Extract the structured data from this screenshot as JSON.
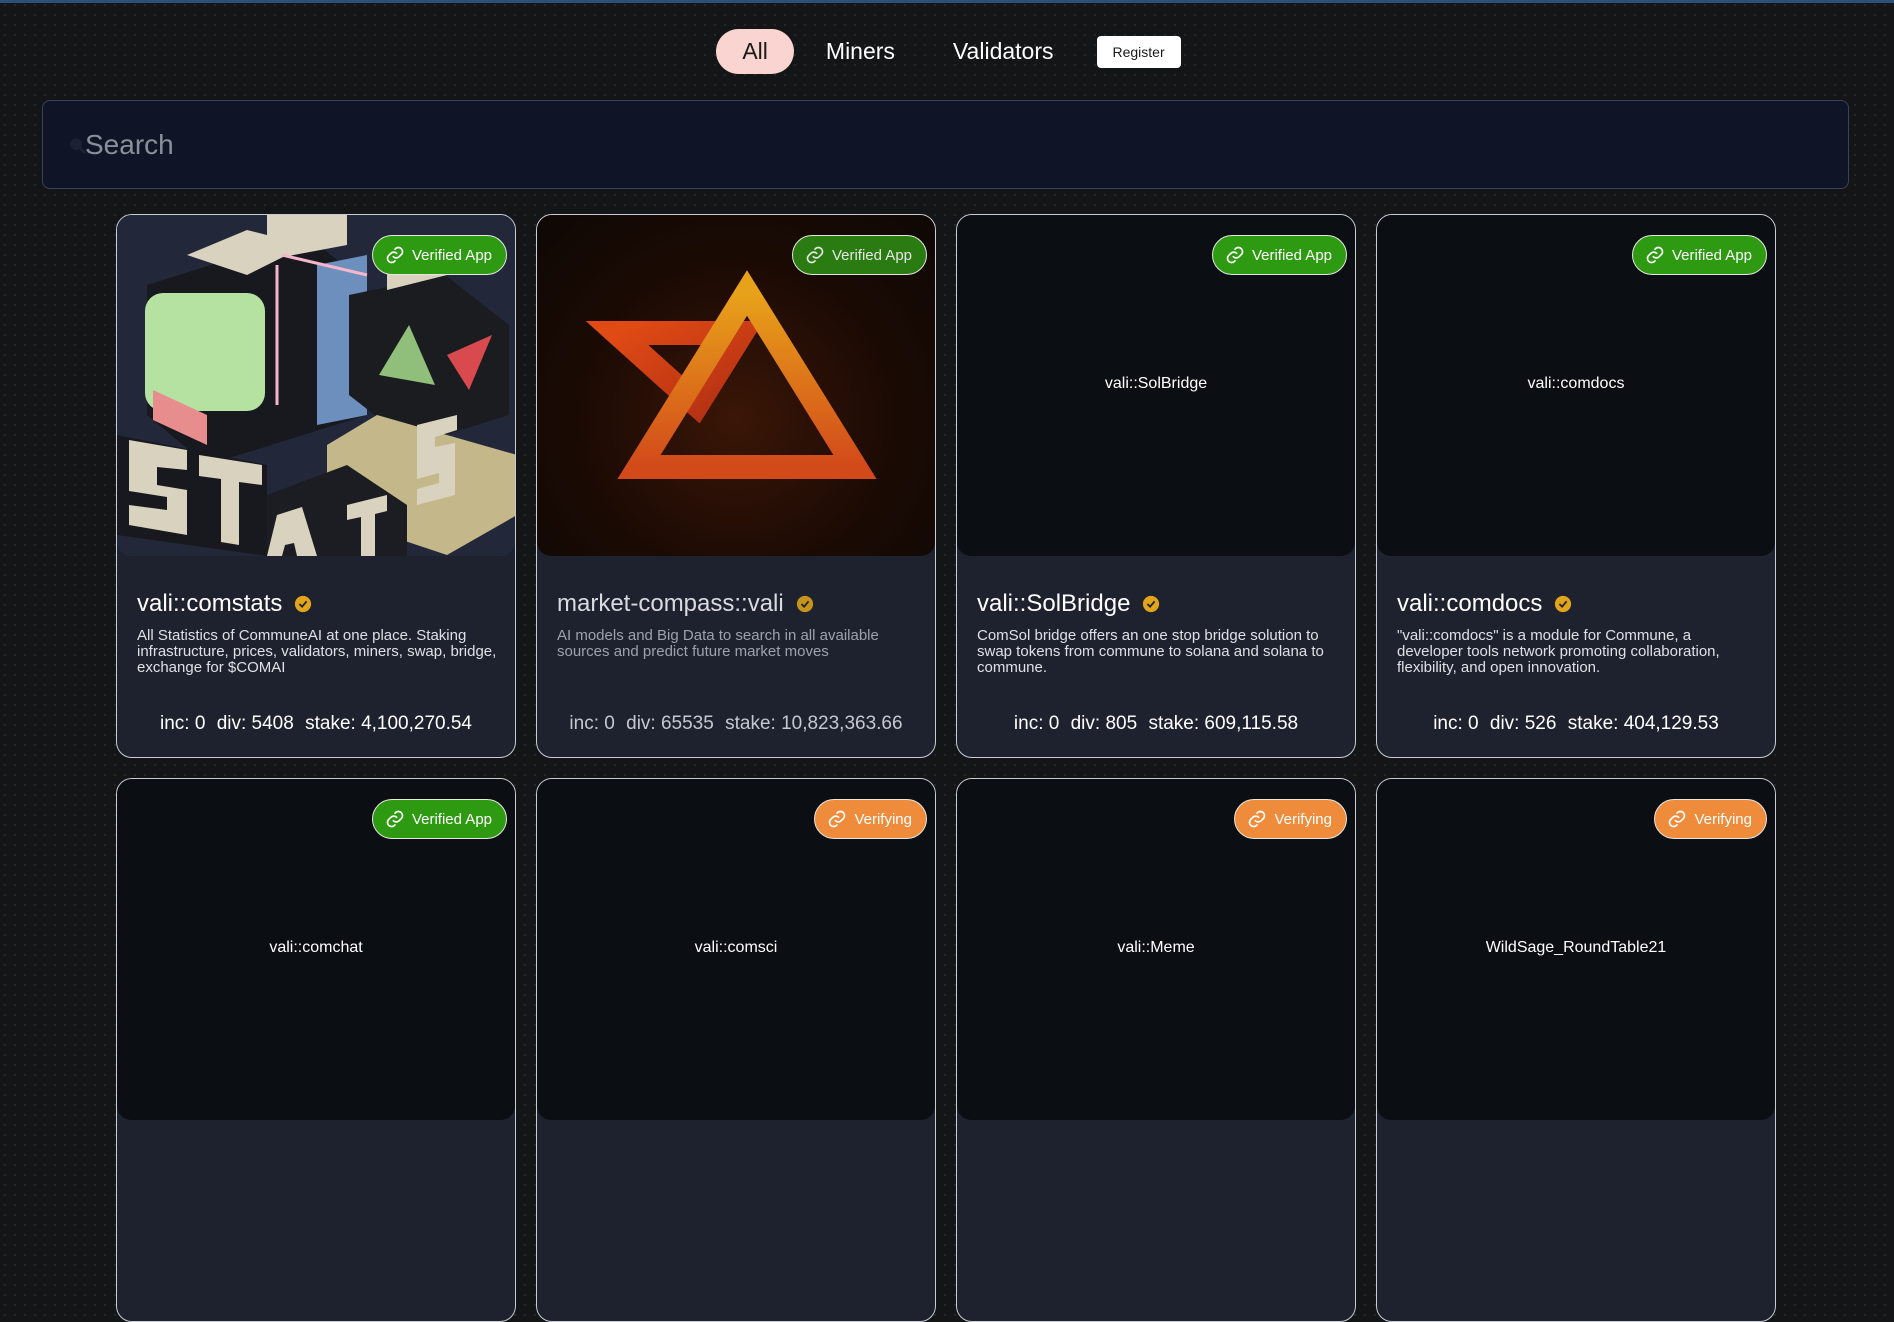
{
  "nav": {
    "tabs": [
      {
        "label": "All"
      },
      {
        "label": "Miners"
      },
      {
        "label": "Validators"
      }
    ],
    "register_label": "Register"
  },
  "search": {
    "placeholder": "Search",
    "value": ""
  },
  "colors": {
    "verified": "#2e9a12",
    "verifying": "#ef8c3b",
    "active_tab": "#f9d4d0",
    "check": "#e0a51a"
  },
  "cards": [
    {
      "image_text": "",
      "badge": "Verified App",
      "title": "vali::comstats",
      "description": "All Statistics of CommuneAI at one place. Staking infrastructure, prices, validators, miners, swap, bridge, exchange for $COMAI",
      "inc": "inc: 0",
      "div": "div: 5408",
      "stake": "stake: 4,100,270.54"
    },
    {
      "image_text": "",
      "badge": "Verified App",
      "title": "market-compass::vali",
      "description": "AI models and Big Data to search in all available sources and predict future market moves",
      "inc": "inc: 0",
      "div": "div: 65535",
      "stake": "stake: 10,823,363.66"
    },
    {
      "image_text": "vali::SolBridge",
      "badge": "Verified App",
      "title": "vali::SolBridge",
      "description": "ComSol bridge offers an one stop bridge solution to swap tokens from commune to solana and solana to commune.",
      "inc": "inc: 0",
      "div": "div: 805",
      "stake": "stake: 609,115.58"
    },
    {
      "image_text": "vali::comdocs",
      "badge": "Verified App",
      "title": "vali::comdocs",
      "description": "\"vali::comdocs\" is a module for Commune, a developer tools network promoting collaboration, flexibility, and open innovation.",
      "inc": "inc: 0",
      "div": "div: 526",
      "stake": "stake: 404,129.53"
    },
    {
      "image_text": "vali::comchat",
      "badge": "Verified App"
    },
    {
      "image_text": "vali::comsci",
      "badge": "Verifying"
    },
    {
      "image_text": "vali::Meme",
      "badge": "Verifying"
    },
    {
      "image_text": "WildSage_RoundTable21",
      "badge": "Verifying"
    }
  ]
}
